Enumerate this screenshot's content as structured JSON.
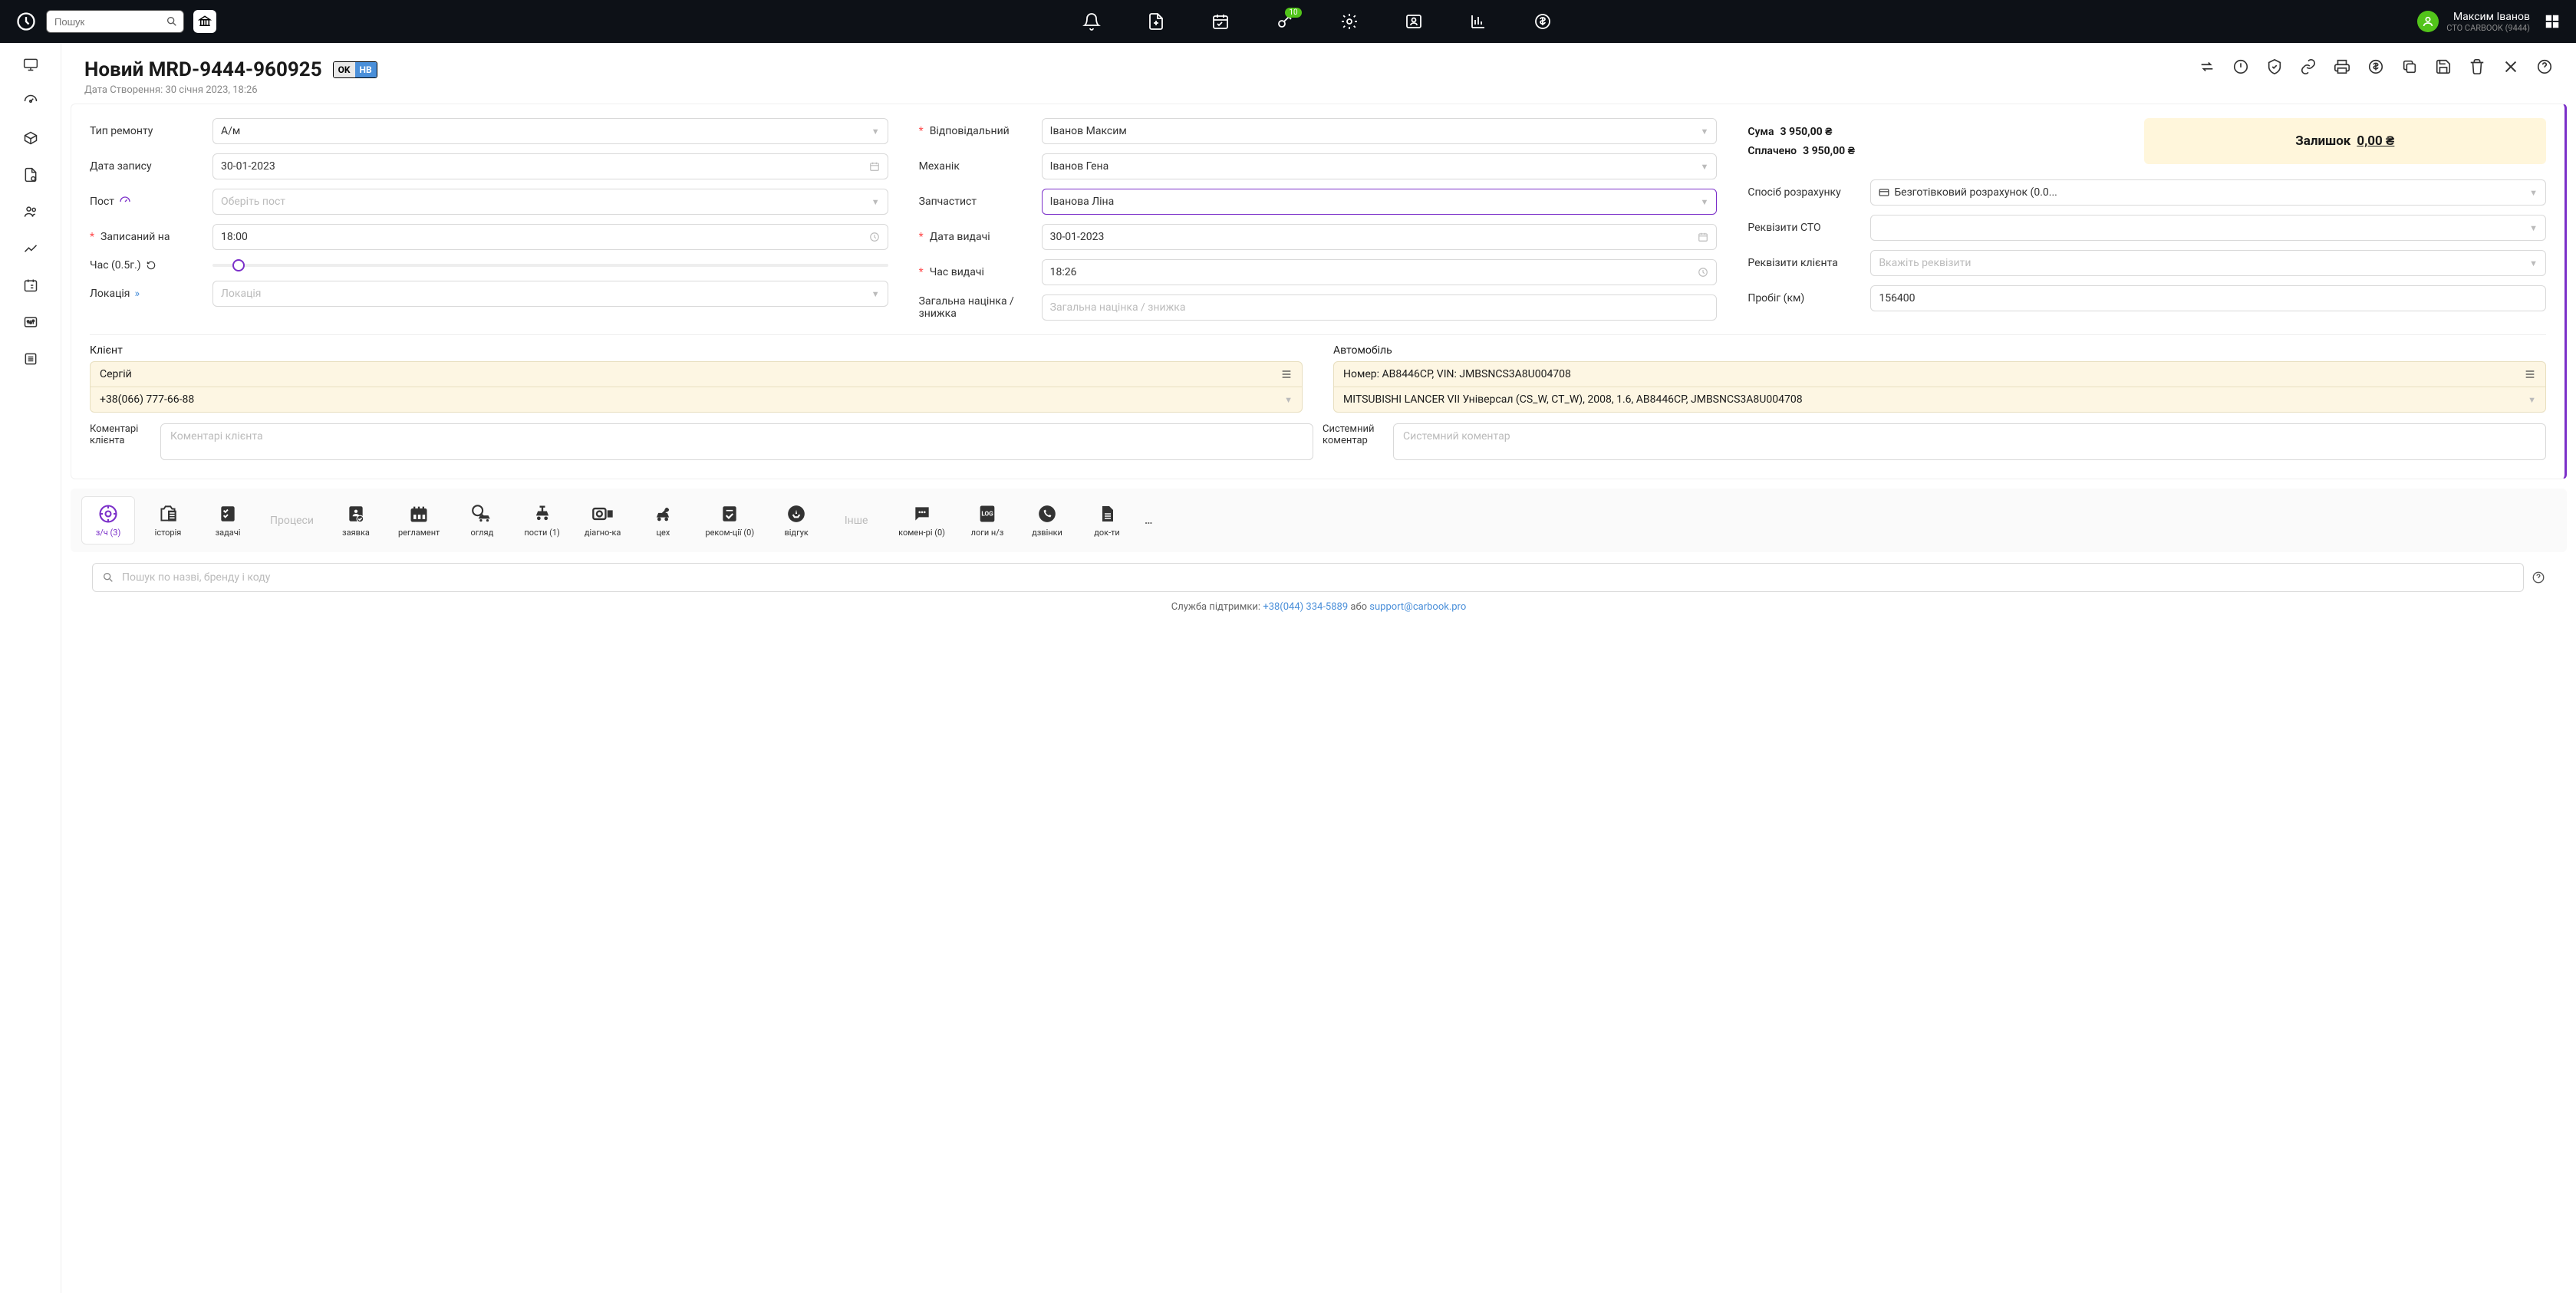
{
  "search_placeholder": "Пошук",
  "key_badge": "10",
  "user": {
    "name": "Максим Іванов",
    "company": "СТО CARBOOK (9444)"
  },
  "page": {
    "title": "Новий MRD-9444-960925",
    "status_ok": "OK",
    "status_nb": "НВ",
    "created_label": "Дата Створення:",
    "created_value": "30 січня 2023, 18:26"
  },
  "form": {
    "repair_type_label": "Тип ремонту",
    "repair_type_value": "А/м",
    "date_label": "Дата запису",
    "date_value": "30-01-2023",
    "post_label": "Пост",
    "post_placeholder": "Оберіть пост",
    "scheduled_label": "Записаний на",
    "scheduled_value": "18:00",
    "duration_label": "Час (0.5г.)",
    "location_label": "Локація",
    "location_placeholder": "Локація",
    "responsible_label": "Відповідальний",
    "responsible_value": "Іванов Максим",
    "mechanic_label": "Механік",
    "mechanic_value": "Іванов Гена",
    "parts_label": "Запчастист",
    "parts_value": "Іванова Ліна",
    "delivery_date_label": "Дата видачі",
    "delivery_date_value": "30-01-2023",
    "delivery_time_label": "Час видачі",
    "delivery_time_value": "18:26",
    "markup_label": "Загальна націнка / знижка",
    "markup_placeholder": "Загальна націнка / знижка",
    "sum_label": "Сума",
    "sum_value": "3 950,00 ₴",
    "paid_label": "Сплачено",
    "paid_value": "3 950,00 ₴",
    "balance_label": "Залишок",
    "balance_value": "0,00 ₴",
    "paymethod_label": "Спосіб розрахунку",
    "paymethod_value": "Безготівковий розрахунок (0.0...",
    "sto_req_label": "Реквізити СТО",
    "client_req_label": "Реквізити клієнта",
    "client_req_placeholder": "Вкажіть реквізити",
    "mileage_label": "Пробіг (км)",
    "mileage_value": "156400"
  },
  "client": {
    "section_label": "Клієнт",
    "name": "Сергій",
    "phone": "+38(066) 777-66-88"
  },
  "vehicle": {
    "section_label": "Автомобіль",
    "line1": "Номер: AB8446CP,  VIN: JMBSNCS3A8U004708",
    "line2": "MITSUBISHI LANCER VII Універсал (CS_W, CT_W), 2008, 1.6, AB8446CP, JMBSNCS3A8U004708"
  },
  "comments": {
    "client_label": "Коментарі клієнта",
    "client_placeholder": "Коментарі клієнта",
    "system_label": "Системний коментар",
    "system_placeholder": "Системний коментар"
  },
  "tabs": {
    "parts": "з/ч (3)",
    "history": "історія",
    "tasks": "задачі",
    "processes": "Процеси",
    "request": "заявка",
    "regulation": "регламент",
    "inspect": "огляд",
    "posts": "пости (1)",
    "diag": "діагно-ка",
    "workshop": "цех",
    "recom": "реком-ції (0)",
    "review": "відгук",
    "other": "Інше",
    "comments": "комен-рі (0)",
    "logs": "логи н/з",
    "calls": "дзвінки",
    "docs": "док-ти"
  },
  "tab_search_placeholder": "Пошук по назві, бренду і коду",
  "footer": {
    "prefix": "Служба підтримки: ",
    "phone": "+38(044) 334-5889",
    "mid": " або ",
    "email": "support@carbook.pro"
  }
}
